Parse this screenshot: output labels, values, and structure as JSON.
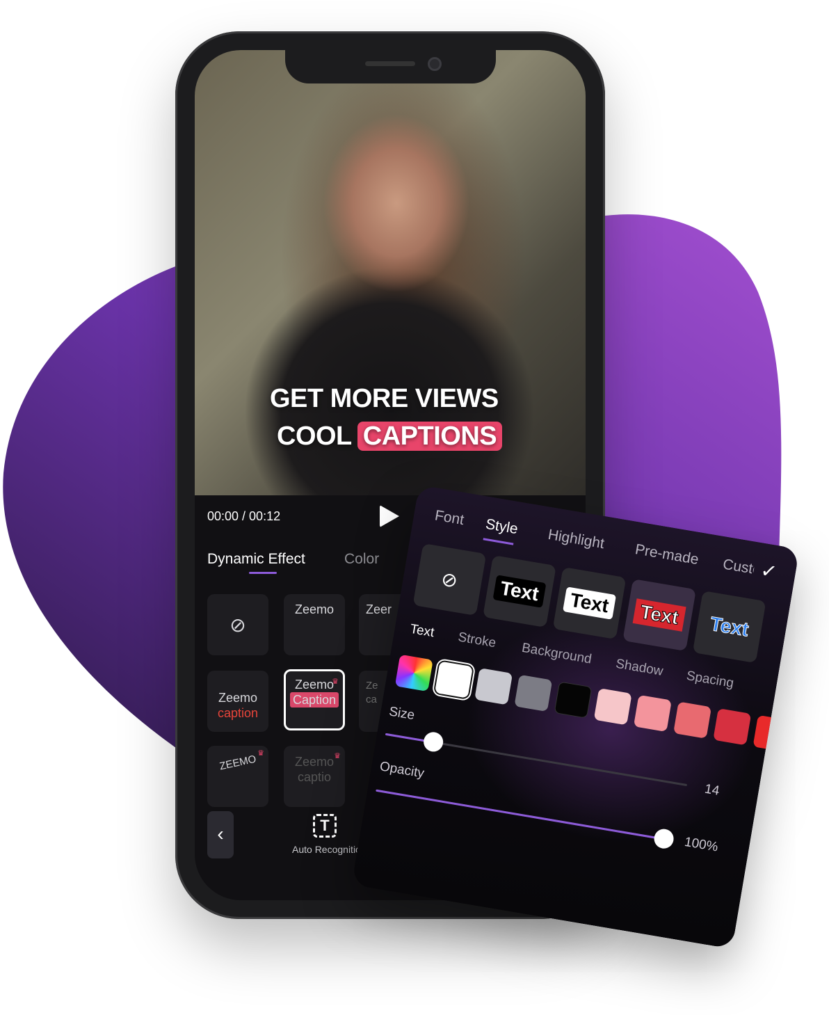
{
  "colors": {
    "accent": "#8d5bd9",
    "highlight": "#e8456a",
    "blob_start": "#3a1f5c",
    "blob_end": "#9a46c8"
  },
  "video": {
    "caption_line1": "GET MORE VIEWS",
    "caption_line2a": "COOL",
    "caption_line2b": "CAPTIONS",
    "time": "00:00 / 00:12",
    "play_icon": "play-icon"
  },
  "tabs": [
    {
      "label": "Dynamic Effect",
      "active": true
    },
    {
      "label": "Color",
      "active": false
    }
  ],
  "effects": [
    {
      "label": "",
      "icon": "none-icon"
    },
    {
      "label": "Zeemo"
    },
    {
      "label": "Zeer"
    },
    {
      "label1": "Zeemo",
      "label2": "caption"
    },
    {
      "label1": "Zeemo",
      "label2": "Caption",
      "selected": true,
      "premium": true
    },
    {
      "label1": "Ze",
      "label2": "ca"
    },
    {
      "label": "ZEEMO",
      "premium": true
    },
    {
      "label1": "Zeemo",
      "label2": "captio",
      "premium": true
    }
  ],
  "bottom": {
    "back_icon": "chevron-left-icon",
    "auto_label": "Auto Recognition",
    "auto_icon_glyph": "T"
  },
  "panel": {
    "tabs": [
      {
        "label": "Font"
      },
      {
        "label": "Style",
        "active": true
      },
      {
        "label": "Highlight"
      },
      {
        "label": "Pre-made"
      },
      {
        "label": "Custom"
      }
    ],
    "confirm_icon": "check-icon",
    "styles": [
      {
        "label": "",
        "icon": "none-icon"
      },
      {
        "label": "Text"
      },
      {
        "label": "Text"
      },
      {
        "label": "Text"
      },
      {
        "label": "Text"
      }
    ],
    "subtabs": [
      {
        "label": "Text",
        "active": true
      },
      {
        "label": "Stroke"
      },
      {
        "label": "Background"
      },
      {
        "label": "Shadow"
      },
      {
        "label": "Spacing"
      }
    ],
    "swatches": [
      "rainbow",
      "#ffffff",
      "#c8c8cf",
      "#7c7c85",
      "#050505",
      "#f6c6c9",
      "#f3949c",
      "#e86a70",
      "#d63040",
      "#e82a2a"
    ],
    "selected_swatch": "#ffffff",
    "size": {
      "label": "Size",
      "value": "14",
      "fraction": 0.16
    },
    "opacity": {
      "label": "Opacity",
      "value": "100%",
      "fraction": 1.0
    }
  }
}
